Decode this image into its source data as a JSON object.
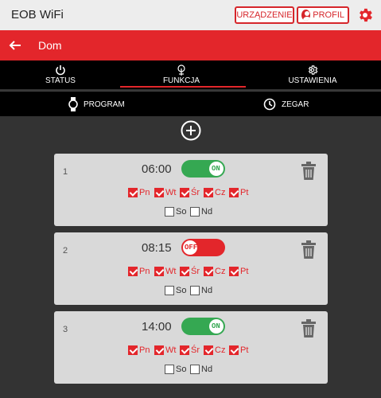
{
  "app": {
    "title": "EOB WiFi"
  },
  "topbar": {
    "device_button": "URZĄDZENIE",
    "profile_button": "PROFIL"
  },
  "header": {
    "title": "Dom"
  },
  "tabs": [
    {
      "label": "STATUS",
      "icon": "power-icon"
    },
    {
      "label": "FUNKCJA",
      "icon": "tree-icon",
      "active": true
    },
    {
      "label": "USTAWIENIA",
      "icon": "gear-icon"
    }
  ],
  "subtabs": [
    {
      "label": "PROGRAM",
      "icon": "watch-icon"
    },
    {
      "label": "ZEGAR",
      "icon": "clock-icon"
    }
  ],
  "schedules": [
    {
      "number": "1",
      "time": "06:00",
      "toggle": "ON",
      "enabled": true,
      "days": [
        {
          "label": "Pn",
          "checked": true
        },
        {
          "label": "Wt",
          "checked": true
        },
        {
          "label": "Śr",
          "checked": true
        },
        {
          "label": "Cz",
          "checked": true
        },
        {
          "label": "Pt",
          "checked": true
        },
        {
          "label": "So",
          "checked": false
        },
        {
          "label": "Nd",
          "checked": false
        }
      ]
    },
    {
      "number": "2",
      "time": "08:15",
      "toggle": "OFF",
      "enabled": false,
      "days": [
        {
          "label": "Pn",
          "checked": true
        },
        {
          "label": "Wt",
          "checked": true
        },
        {
          "label": "Śr",
          "checked": true
        },
        {
          "label": "Cz",
          "checked": true
        },
        {
          "label": "Pt",
          "checked": true
        },
        {
          "label": "So",
          "checked": false
        },
        {
          "label": "Nd",
          "checked": false
        }
      ]
    },
    {
      "number": "3",
      "time": "14:00",
      "toggle": "ON",
      "enabled": true,
      "days": [
        {
          "label": "Pn",
          "checked": true
        },
        {
          "label": "Wt",
          "checked": true
        },
        {
          "label": "Śr",
          "checked": true
        },
        {
          "label": "Cz",
          "checked": true
        },
        {
          "label": "Pt",
          "checked": true
        },
        {
          "label": "So",
          "checked": false
        },
        {
          "label": "Nd",
          "checked": false
        }
      ]
    }
  ],
  "colors": {
    "accent": "#e3262b",
    "toggle_on": "#35a852",
    "background": "#333333"
  }
}
